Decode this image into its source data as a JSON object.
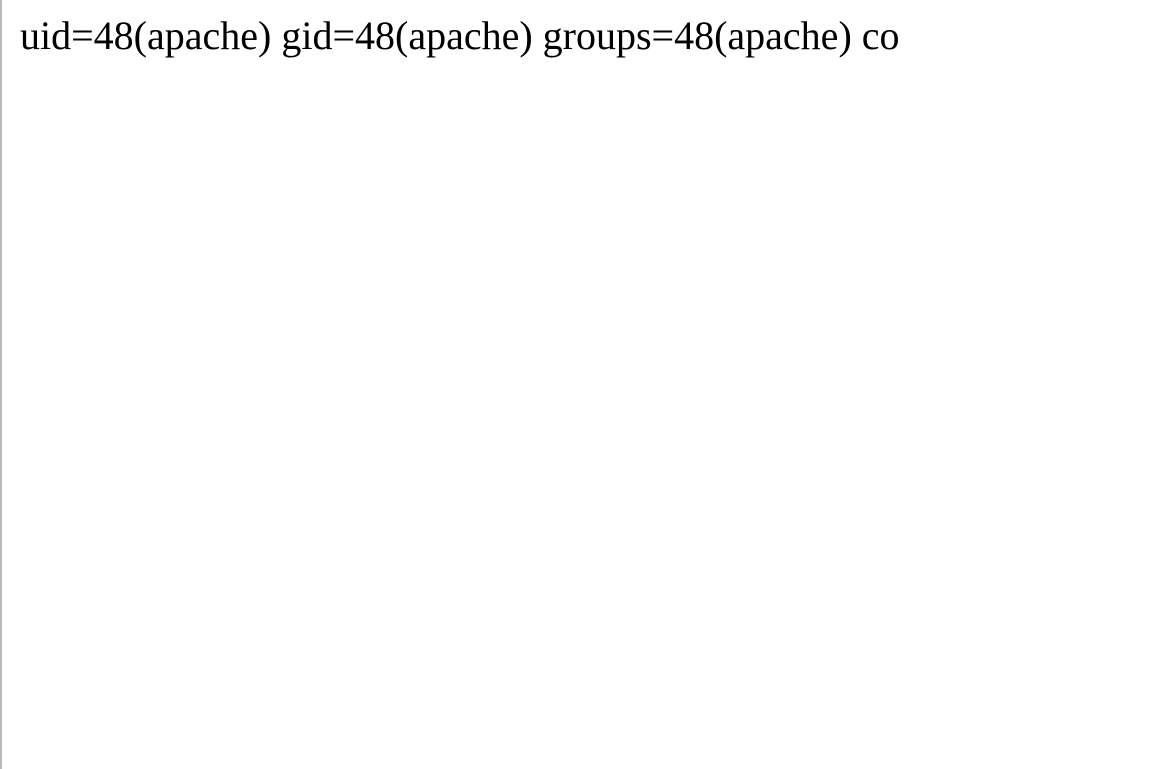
{
  "body": {
    "output_text": "uid=48(apache) gid=48(apache) groups=48(apache) co"
  }
}
